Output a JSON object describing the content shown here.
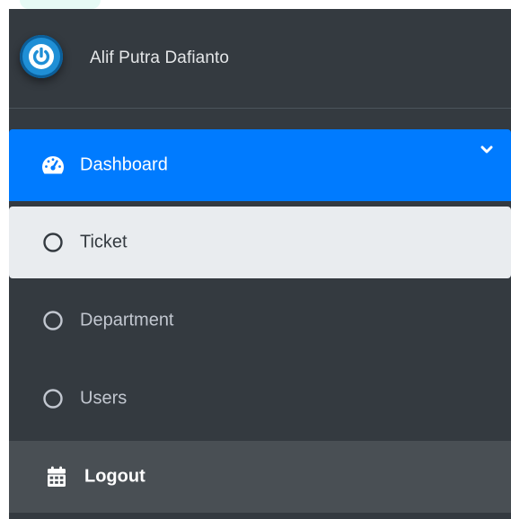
{
  "brand": {
    "user_name": "Alif Putra Dafianto",
    "avatar_icon": "power-icon"
  },
  "nav": {
    "items": [
      {
        "label": "Dashboard",
        "icon": "tachometer-icon",
        "state": "active",
        "expand_icon": "chevron-down-icon"
      },
      {
        "label": "Ticket",
        "icon": "circle-outline-icon",
        "state": "selected"
      },
      {
        "label": "Department",
        "icon": "circle-outline-icon",
        "state": "default"
      },
      {
        "label": "Users",
        "icon": "circle-outline-icon",
        "state": "default"
      },
      {
        "label": "Logout",
        "icon": "calendar-icon",
        "state": "highlighted"
      }
    ]
  },
  "colors": {
    "sidebar_bg": "#343a40",
    "active_bg": "#007bff",
    "selected_bg": "#e9ecef",
    "logout_bg": "#494f54",
    "avatar_blue": "#1f8fd6"
  }
}
